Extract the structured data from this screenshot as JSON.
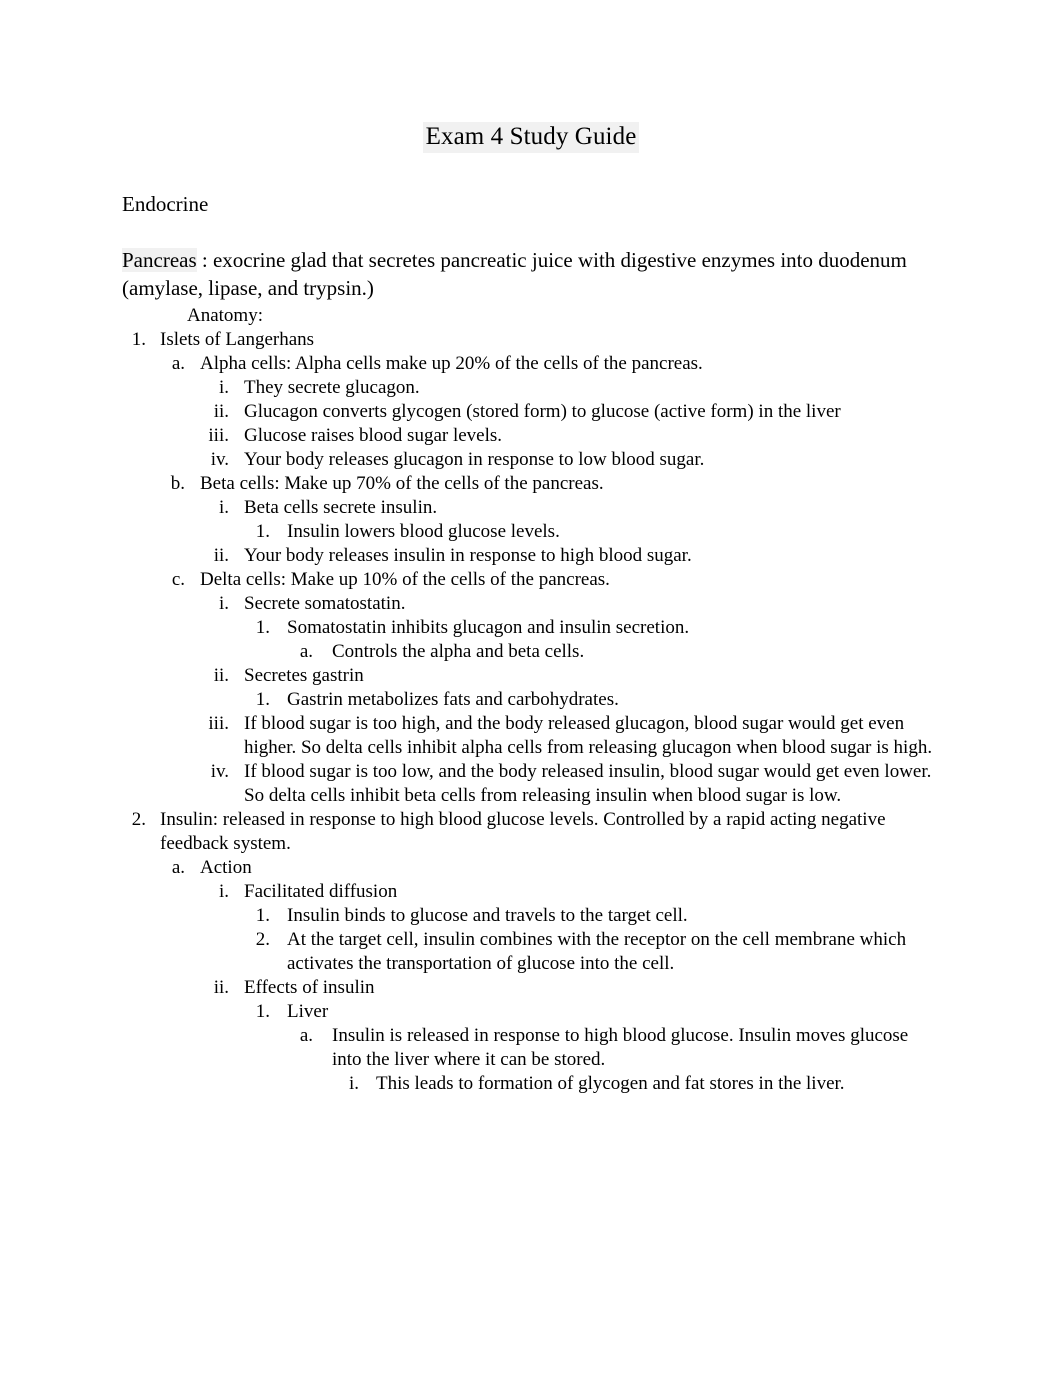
{
  "document": {
    "title": "Exam 4 Study Guide",
    "section_heading": "Endocrine",
    "intro": {
      "term": "Pancreas",
      "rest": " : exocrine glad that secretes pancreatic juice with digestive enzymes into duodenum (amylase, lipase, and trypsin.)"
    },
    "anatomy_label": "Anatomy:",
    "outline": {
      "item1": {
        "marker": "1.",
        "text": "Islets of Langerhans",
        "alpha": {
          "marker": "a.",
          "text": "Alpha cells: Alpha cells make up 20% of the cells of the pancreas.",
          "i": {
            "marker": "i.",
            "text": "They secrete glucagon."
          },
          "ii": {
            "marker": "ii.",
            "text": "Glucagon converts glycogen (stored form) to glucose (active form) in the liver"
          },
          "iii": {
            "marker": "iii.",
            "text": "Glucose raises blood sugar levels."
          },
          "iv": {
            "marker": "iv.",
            "text": "Your body releases glucagon in response to low blood sugar."
          }
        },
        "beta": {
          "marker": "b.",
          "text": "Beta cells:  Make up 70% of the cells of the pancreas.",
          "i": {
            "marker": "i.",
            "text": "Beta cells secrete insulin.",
            "one": {
              "marker": "1.",
              "text": "Insulin lowers blood glucose levels."
            }
          },
          "ii": {
            "marker": "ii.",
            "text": "Your body releases insulin in response to high blood sugar."
          }
        },
        "delta": {
          "marker": "c.",
          "text": "Delta cells:  Make up 10% of the cells of the pancreas.",
          "i": {
            "marker": "i.",
            "text": "Secrete somatostatin.",
            "one": {
              "marker": "1.",
              "text": "Somatostatin inhibits glucagon and insulin secretion.",
              "a": {
                "marker": "a.",
                "text": "Controls the alpha and beta cells."
              }
            }
          },
          "ii": {
            "marker": "ii.",
            "text": "Secretes gastrin",
            "one": {
              "marker": "1.",
              "text": "Gastrin metabolizes fats and carbohydrates."
            }
          },
          "iii": {
            "marker": "iii.",
            "text": "If blood sugar is too high, and the body released glucagon, blood sugar would get even higher. So delta cells inhibit alpha cells from releasing glucagon when blood sugar is high."
          },
          "iv": {
            "marker": "iv.",
            "text": "If blood sugar is too low, and the body released insulin, blood sugar would get even lower. So delta cells inhibit beta cells from releasing insulin when blood sugar is low."
          }
        }
      },
      "item2": {
        "marker": "2.",
        "text": "Insulin: released in response to high blood glucose levels. Controlled by a rapid acting negative feedback system.",
        "action": {
          "marker": "a.",
          "text": "Action",
          "i": {
            "marker": "i.",
            "text": "Facilitated diffusion",
            "one": {
              "marker": "1.",
              "text": "Insulin binds to glucose and travels to the target cell."
            },
            "two": {
              "marker": "2.",
              "text": "At the target cell, insulin combines with the receptor on the cell membrane which activates the transportation of glucose into the cell."
            }
          },
          "ii": {
            "marker": "ii.",
            "text": "Effects of insulin",
            "one": {
              "marker": "1.",
              "text": "Liver",
              "a": {
                "marker": "a.",
                "text": "Insulin is released in response to high blood glucose. Insulin moves glucose into the liver where it can be stored.",
                "i": {
                  "marker": "i.",
                  "text": "This leads to formation of glycogen and fat stores in the liver."
                }
              }
            }
          }
        }
      }
    }
  }
}
